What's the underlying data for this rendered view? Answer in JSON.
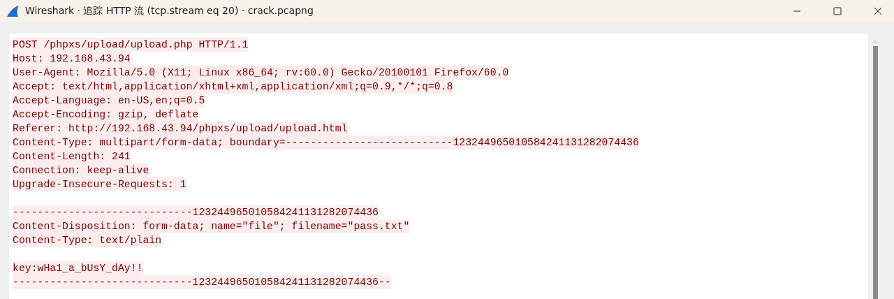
{
  "window": {
    "title": "Wireshark · 追踪 HTTP 流 (tcp.stream eq 20) · crack.pcapng"
  },
  "stream": [
    {
      "kind": "client",
      "text": "POST /phpxs/upload/upload.php HTTP/1.1"
    },
    {
      "kind": "client",
      "text": "Host: 192.168.43.94"
    },
    {
      "kind": "client",
      "text": "User-Agent: Mozilla/5.0 (X11; Linux x86_64; rv:60.0) Gecko/20100101 Firefox/60.0"
    },
    {
      "kind": "client",
      "text": "Accept: text/html,application/xhtml+xml,application/xml;q=0.9,*/*;q=0.8"
    },
    {
      "kind": "client",
      "text": "Accept-Language: en-US,en;q=0.5"
    },
    {
      "kind": "client",
      "text": "Accept-Encoding: gzip, deflate"
    },
    {
      "kind": "client",
      "text": "Referer: http://192.168.43.94/phpxs/upload/upload.html"
    },
    {
      "kind": "client",
      "text": "Content-Type: multipart/form-data; boundary=---------------------------123244965010584241131282074436"
    },
    {
      "kind": "client",
      "text": "Content-Length: 241"
    },
    {
      "kind": "client",
      "text": "Connection: keep-alive"
    },
    {
      "kind": "client",
      "text": "Upgrade-Insecure-Requests: 1"
    },
    {
      "kind": "blank"
    },
    {
      "kind": "client",
      "text": "-----------------------------123244965010584241131282074436"
    },
    {
      "kind": "client",
      "text": "Content-Disposition: form-data; name=\"file\"; filename=\"pass.txt\""
    },
    {
      "kind": "client",
      "text": "Content-Type: text/plain"
    },
    {
      "kind": "blank"
    },
    {
      "kind": "client",
      "text": "key:wHa1_a_bUsY_dAy!!"
    },
    {
      "kind": "client",
      "text": "-----------------------------123244965010584241131282074436--"
    }
  ]
}
